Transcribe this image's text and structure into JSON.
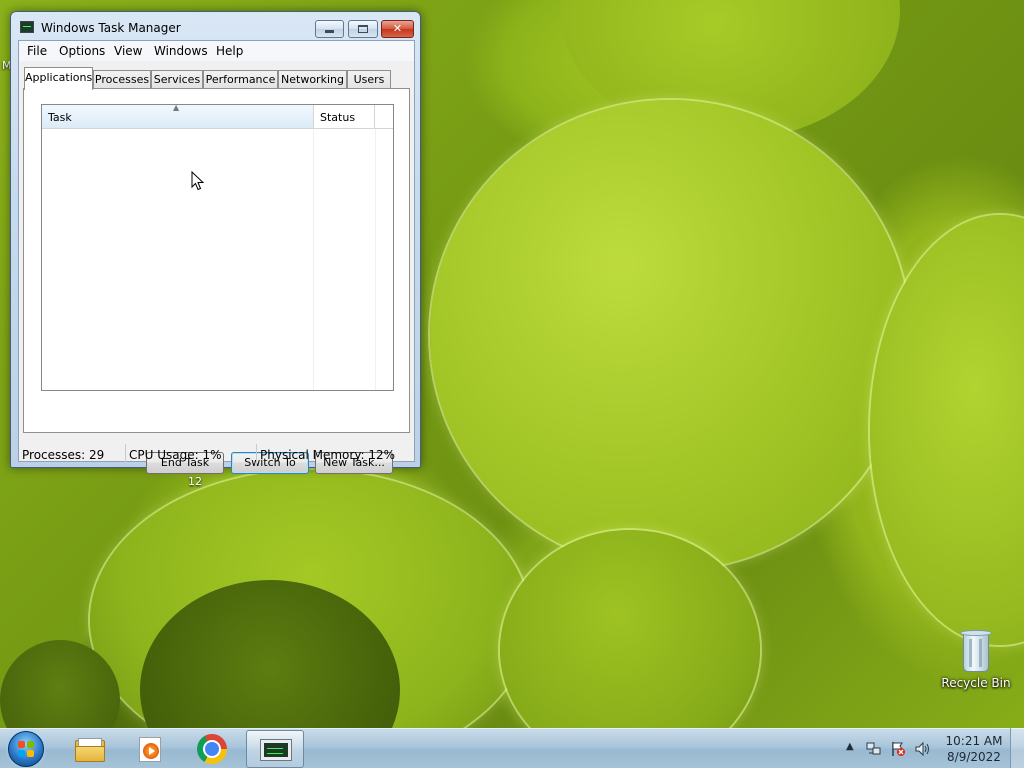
{
  "window": {
    "title": "Windows Task Manager"
  },
  "menu": [
    "File",
    "Options",
    "View",
    "Windows",
    "Help"
  ],
  "tabs": [
    "Applications",
    "Processes",
    "Services",
    "Performance",
    "Networking",
    "Users"
  ],
  "active_tab": "Applications",
  "listview": {
    "columns": [
      "Task",
      "Status"
    ],
    "rows": []
  },
  "buttons": {
    "end_task": "End Task",
    "switch_to": "Switch To",
    "new_task": "New Task..."
  },
  "statusbar": {
    "processes": "Processes: 29",
    "cpu": "CPU Usage: 1%",
    "memory": "Physical Memory: 12%"
  },
  "desktop": {
    "recycle_bin_label": "Recycle Bin",
    "stray_label_left": "M",
    "stray_label_below_window": "12"
  },
  "taskbar": {
    "pinned": [
      "windows-explorer",
      "media-player",
      "chrome",
      "task-manager"
    ],
    "active_app": "task-manager",
    "clock_time": "10:21 AM",
    "clock_date": "8/9/2022"
  },
  "colors": {
    "title_close": "#c5351c",
    "focus_button_border": "#3c7fb1",
    "taskbar": "#a9c5da"
  }
}
